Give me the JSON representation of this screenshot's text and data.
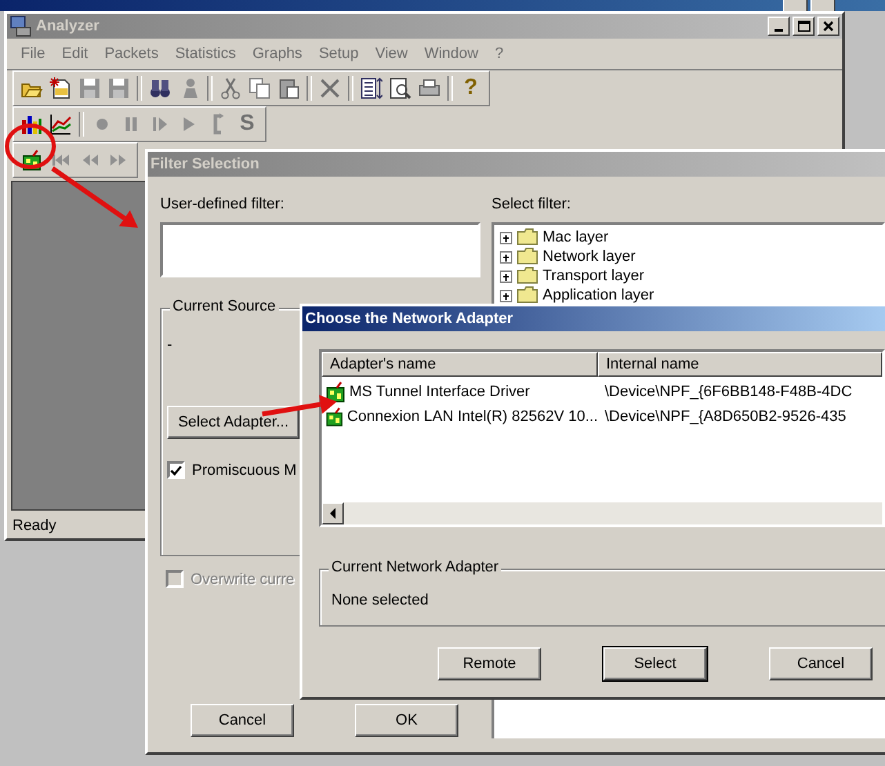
{
  "analyzer": {
    "title": "Analyzer",
    "menu": [
      "File",
      "Edit",
      "Packets",
      "Statistics",
      "Graphs",
      "Setup",
      "View",
      "Window",
      "?"
    ],
    "toolbars": [
      [
        {
          "kind": "open"
        },
        {
          "kind": "new"
        },
        {
          "kind": "save"
        },
        {
          "kind": "save"
        },
        {
          "kind": "separator"
        },
        {
          "kind": "binoculars"
        },
        {
          "kind": "figure"
        },
        {
          "kind": "separator"
        },
        {
          "kind": "scissors"
        },
        {
          "kind": "copy"
        },
        {
          "kind": "paste"
        },
        {
          "kind": "separator"
        },
        {
          "kind": "cross"
        },
        {
          "kind": "separator"
        },
        {
          "kind": "list"
        },
        {
          "kind": "preview"
        },
        {
          "kind": "printer"
        },
        {
          "kind": "separator"
        },
        {
          "kind": "glyph",
          "glyph": "?"
        }
      ],
      [
        {
          "kind": "barchart"
        },
        {
          "kind": "linechart"
        },
        {
          "kind": "separator"
        },
        {
          "kind": "record"
        },
        {
          "kind": "pause"
        },
        {
          "kind": "step"
        },
        {
          "kind": "play"
        },
        {
          "kind": "loop"
        },
        {
          "kind": "glyph",
          "glyph": "S"
        }
      ],
      [
        {
          "kind": "adapter"
        },
        {
          "kind": "first"
        },
        {
          "kind": "rewind"
        },
        {
          "kind": "forward"
        }
      ]
    ],
    "status": "Ready"
  },
  "filter_dialog": {
    "title": "Filter Selection",
    "user_filter_label": "User-defined filter:",
    "select_filter_label": "Select filter:",
    "filter_tree": [
      {
        "label": "Mac layer",
        "expanded": false
      },
      {
        "label": "Network layer",
        "expanded": false
      },
      {
        "label": "Transport layer",
        "expanded": false
      },
      {
        "label": "Application layer",
        "expanded": false
      }
    ],
    "current_source": {
      "title": "Current Source",
      "value": "-",
      "select_button": "Select Adapter...",
      "promiscuous": {
        "label": "Promiscuous M",
        "checked": true
      }
    },
    "overwrite": {
      "label": "Overwrite curre",
      "checked": false,
      "disabled": true
    },
    "buttons": [
      "Cancel",
      "OK"
    ]
  },
  "adapter_dialog": {
    "title": "Choose the Network Adapter",
    "columns": [
      "Adapter's name",
      "Internal name"
    ],
    "rows": [
      {
        "name": "MS Tunnel Interface Driver",
        "internal": "\\Device\\NPF_{6F6BB148-F48B-4DC",
        "selected": false
      },
      {
        "name": "Connexion LAN Intel(R) 82562V 10...",
        "internal": "\\Device\\NPF_{A8D650B2-9526-435",
        "selected": false
      }
    ],
    "current": {
      "title": "Current Network Adapter",
      "value": "None selected"
    },
    "buttons": [
      {
        "label": "Remote",
        "default": false
      },
      {
        "label": "Select",
        "default": true
      },
      {
        "label": "Cancel",
        "default": false
      }
    ]
  },
  "annotations": [
    {
      "kind": "circle"
    },
    {
      "kind": "arrow"
    },
    {
      "kind": "arrow"
    }
  ]
}
